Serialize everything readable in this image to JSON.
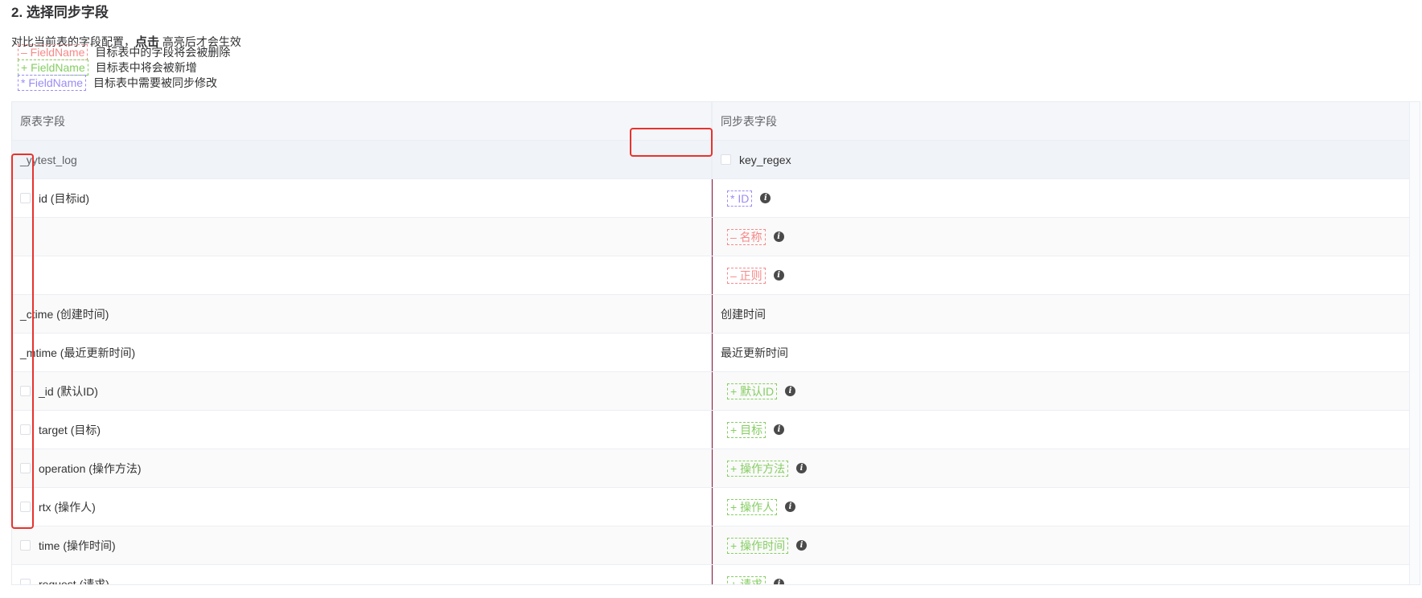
{
  "section_title": "2. 选择同步字段",
  "description": {
    "prefix": "对比当前表的字段配置，",
    "bold": "点击",
    "suffix": " 高亮后才会生效"
  },
  "legend": [
    {
      "tag": "– FieldName",
      "kind": "del",
      "text": "目标表中的字段将会被删除"
    },
    {
      "tag": "+ FieldName",
      "kind": "add",
      "text": "目标表中将会被新增"
    },
    {
      "tag": "* FieldName",
      "kind": "mod",
      "text": "目标表中需要被同步修改"
    }
  ],
  "table": {
    "headers": {
      "left": "原表字段",
      "right": "同步表字段"
    },
    "table_name_row": {
      "left": "_yytest_log",
      "right": "key_regex"
    },
    "rows": [
      {
        "left": "id (目标id)",
        "left_checkbox": true,
        "right": "* ID",
        "right_kind": "mod",
        "info": true
      },
      {
        "left": "",
        "left_checkbox": false,
        "right": "– 名称",
        "right_kind": "del",
        "info": true
      },
      {
        "left": "",
        "left_checkbox": false,
        "right": "– 正则",
        "right_kind": "del",
        "info": true
      },
      {
        "left": "_ctime (创建时间)",
        "left_checkbox": false,
        "right": "创建时间",
        "right_kind": "plain",
        "info": false
      },
      {
        "left": "_mtime (最近更新时间)",
        "left_checkbox": false,
        "right": "最近更新时间",
        "right_kind": "plain",
        "info": false
      },
      {
        "left": "_id (默认ID)",
        "left_checkbox": true,
        "right": "+ 默认ID",
        "right_kind": "add",
        "info": true
      },
      {
        "left": "target (目标)",
        "left_checkbox": true,
        "right": "+ 目标",
        "right_kind": "add",
        "info": true
      },
      {
        "left": "operation (操作方法)",
        "left_checkbox": true,
        "right": "+ 操作方法",
        "right_kind": "add",
        "info": true
      },
      {
        "left": "rtx (操作人)",
        "left_checkbox": true,
        "right": "+ 操作人",
        "right_kind": "add",
        "info": true
      },
      {
        "left": "time (操作时间)",
        "left_checkbox": true,
        "right": "+ 操作时间",
        "right_kind": "add",
        "info": true
      },
      {
        "left": "request (请求)",
        "left_checkbox": true,
        "right": "+ 请求",
        "right_kind": "add",
        "info": true
      }
    ]
  },
  "info_glyph": "i",
  "colors": {
    "delete": "#f78989",
    "add": "#85ce61",
    "modify": "#9a8cf5",
    "highlight_box": "#e8322e"
  }
}
